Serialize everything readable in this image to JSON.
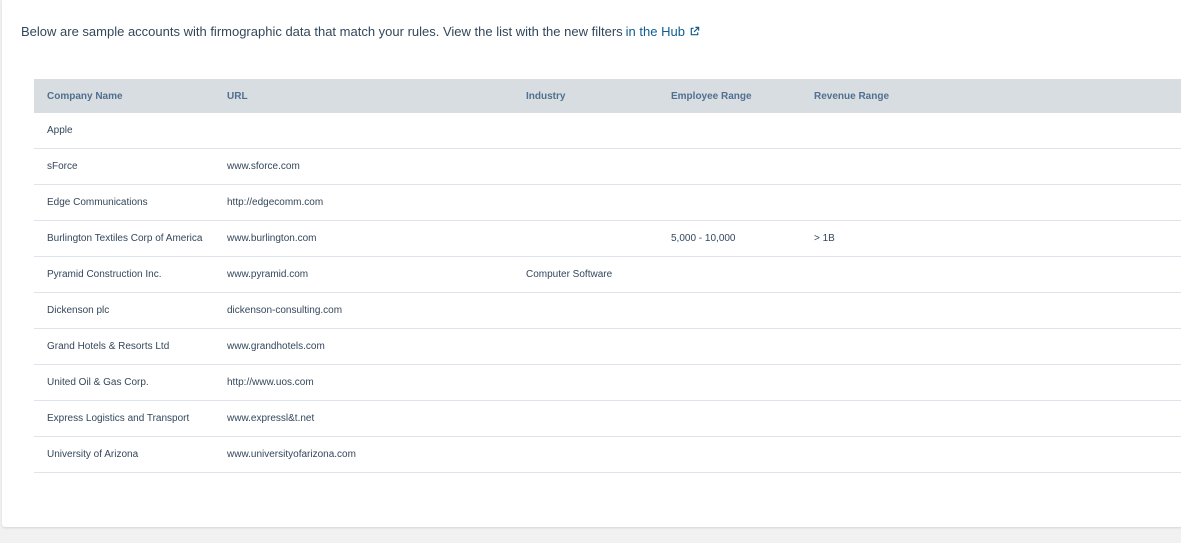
{
  "intro": {
    "text": "Below are sample accounts with firmographic data that match your rules. View the list with the new filters",
    "link_label": "in the Hub",
    "link_icon": "external-link-icon"
  },
  "table": {
    "headers": [
      "Company Name",
      "URL",
      "Industry",
      "Employee Range",
      "Revenue Range"
    ],
    "rows": [
      {
        "company": "Apple",
        "url": "",
        "industry": "",
        "employees": "",
        "revenue": ""
      },
      {
        "company": "sForce",
        "url": "www.sforce.com",
        "industry": "",
        "employees": "",
        "revenue": ""
      },
      {
        "company": "Edge Communications",
        "url": "http://edgecomm.com",
        "industry": "",
        "employees": "",
        "revenue": ""
      },
      {
        "company": "Burlington Textiles Corp of America",
        "url": "www.burlington.com",
        "industry": "",
        "employees": "5,000 - 10,000",
        "revenue": "> 1B"
      },
      {
        "company": "Pyramid Construction Inc.",
        "url": "www.pyramid.com",
        "industry": "Computer Software",
        "employees": "",
        "revenue": ""
      },
      {
        "company": "Dickenson plc",
        "url": "dickenson-consulting.com",
        "industry": "",
        "employees": "",
        "revenue": ""
      },
      {
        "company": "Grand Hotels & Resorts Ltd",
        "url": "www.grandhotels.com",
        "industry": "",
        "employees": "",
        "revenue": ""
      },
      {
        "company": "United Oil & Gas Corp.",
        "url": "http://www.uos.com",
        "industry": "",
        "employees": "",
        "revenue": ""
      },
      {
        "company": "Express Logistics and Transport",
        "url": "www.expressl&t.net",
        "industry": "",
        "employees": "",
        "revenue": ""
      },
      {
        "company": "University of Arizona",
        "url": "www.universityofarizona.com",
        "industry": "",
        "employees": "",
        "revenue": ""
      }
    ]
  },
  "colors": {
    "link": "#0f5c91",
    "header_bg": "#d8dde1",
    "text": "#33475b"
  }
}
